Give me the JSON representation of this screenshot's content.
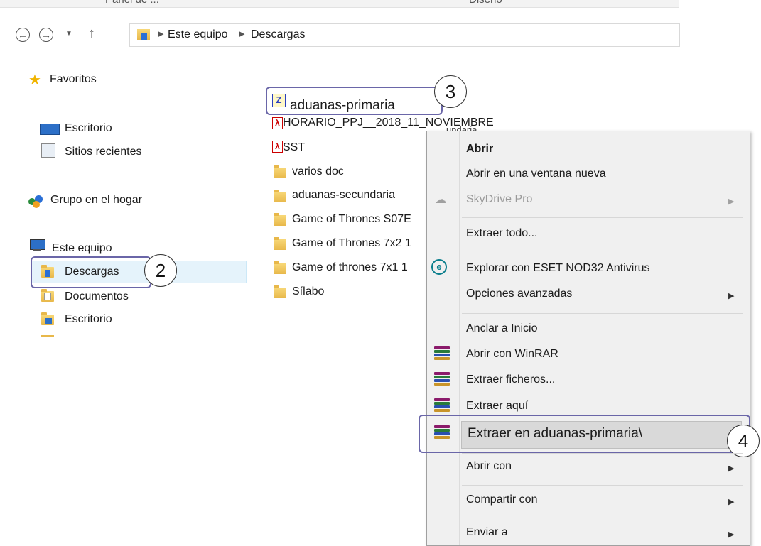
{
  "ribbon": {
    "left_label": "Panel de ...",
    "right_label": "Diseño"
  },
  "address_bar": {
    "path": [
      "Este equipo",
      "Descargas"
    ],
    "back_icon": "back-arrow-icon",
    "forward_icon": "forward-arrow-icon",
    "recent_icon": "chevron-down-icon",
    "up_icon": "up-arrow-icon"
  },
  "nav_pane": {
    "favorites": {
      "label": "Favoritos",
      "items": [
        "Escritorio",
        "Sitios recientes"
      ]
    },
    "homegroup": "Grupo en el hogar",
    "this_pc": {
      "label": "Este equipo",
      "items": [
        "Descargas",
        "Documentos",
        "Escritorio"
      ],
      "selected": "Descargas"
    }
  },
  "files": [
    {
      "name": "aduanas-primaria",
      "type": "zip"
    },
    {
      "name": "HORARIO_PPJ__2018_11_NOVIEMBRE",
      "type": "pdf"
    },
    {
      "name": "SST",
      "type": "pdf"
    },
    {
      "name": "varios doc",
      "type": "folder"
    },
    {
      "name": "aduanas-secundaria",
      "type": "folder"
    },
    {
      "name": "Game of Thrones S07E",
      "type": "folder"
    },
    {
      "name": "Game of Thrones 7x2 1",
      "type": "folder"
    },
    {
      "name": "Game of thrones 7x1 1",
      "type": "folder"
    },
    {
      "name": "Sílabo",
      "type": "folder"
    }
  ],
  "tooltip_fragment": "undaria",
  "callouts": [
    "2",
    "3",
    "4"
  ],
  "context_menu": {
    "items": [
      {
        "label": "Abrir",
        "bold": true
      },
      {
        "label": "Abrir en una ventana nueva"
      },
      {
        "label": "SkyDrive Pro",
        "disabled": true,
        "submenu": true,
        "icon": "cloud-icon"
      },
      {
        "label": "Extraer todo..."
      },
      {
        "label": "Explorar con ESET NOD32 Antivirus",
        "icon": "eset-icon"
      },
      {
        "label": "Opciones avanzadas",
        "submenu": true
      },
      {
        "label": "Anclar a Inicio"
      },
      {
        "label": "Abrir con WinRAR",
        "icon": "winrar-icon"
      },
      {
        "label": "Extraer ficheros...",
        "icon": "winrar-icon"
      },
      {
        "label": "Extraer aquí",
        "icon": "winrar-icon"
      },
      {
        "label": "Extraer en aduanas-primaria\\",
        "icon": "winrar-icon",
        "highlighted": true
      },
      {
        "label": "Abrir con",
        "submenu": true
      },
      {
        "label": "Compartir con",
        "submenu": true
      },
      {
        "label": "Enviar a",
        "submenu": true
      }
    ]
  },
  "colors": {
    "callout_border": "#6a66a8",
    "selection": "#e5f3fb",
    "highlight": "#d9d9d9",
    "pdf_red": "#cc0000"
  }
}
